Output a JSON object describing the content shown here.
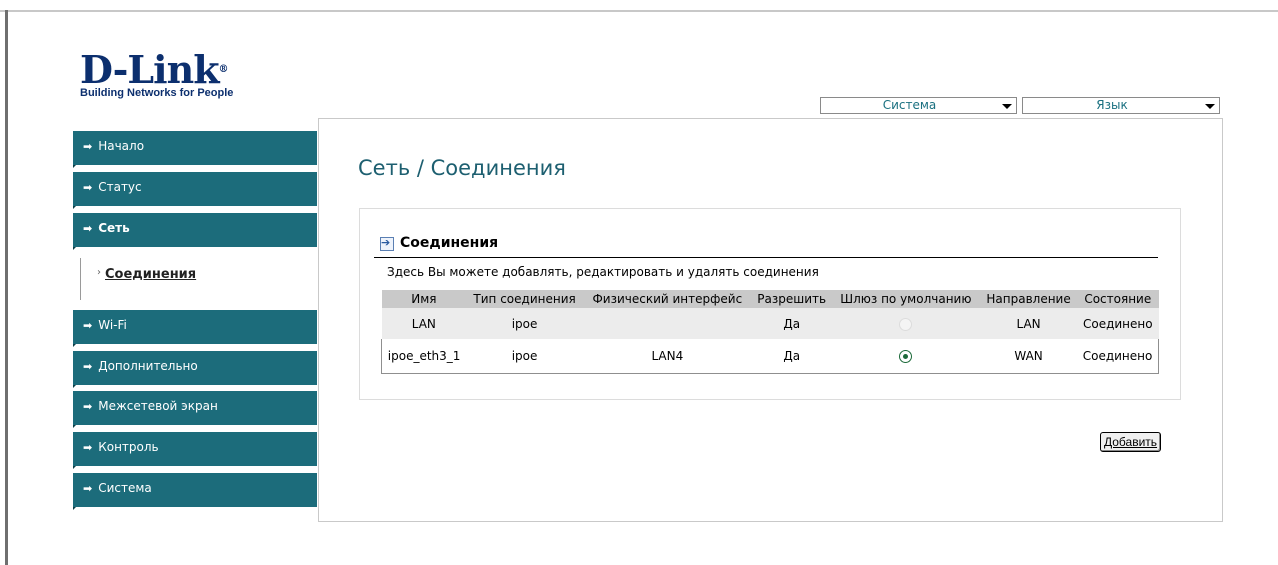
{
  "logo": {
    "name": "D-Link",
    "tagline": "Building Networks for People"
  },
  "header": {
    "system_menu": "Система",
    "language_menu": "Язык"
  },
  "sidebar": {
    "items": [
      {
        "label": "Начало"
      },
      {
        "label": "Статус"
      },
      {
        "label": "Сеть"
      },
      {
        "label": "Wi-Fi"
      },
      {
        "label": "Дополнительно"
      },
      {
        "label": "Межсетевой экран"
      },
      {
        "label": "Контроль"
      },
      {
        "label": "Система"
      }
    ],
    "submenu": {
      "label": "Соединения"
    }
  },
  "main": {
    "title": "Сеть / Соединения",
    "panel_title": "Соединения",
    "description": "Здесь Вы можете добавлять, редактировать и удалять соединения",
    "columns": [
      "Имя",
      "Тип соединения",
      "Физический интерфейс",
      "Разрешить",
      "Шлюз по умолчанию",
      "Направление",
      "Состояние"
    ],
    "rows": [
      {
        "name": "LAN",
        "type": "ipoe",
        "iface": "",
        "enabled": "Да",
        "default_gw": "disabled",
        "direction": "LAN",
        "state": "Соединено"
      },
      {
        "name": "ipoe_eth3_1",
        "type": "ipoe",
        "iface": "LAN4",
        "enabled": "Да",
        "default_gw": "checked",
        "direction": "WAN",
        "state": "Соединено"
      }
    ],
    "add_button": "Добавить"
  },
  "colors": {
    "menu_bg": "#1c6c7b",
    "title": "#1d5f70",
    "logo": "#0c2f6e"
  }
}
